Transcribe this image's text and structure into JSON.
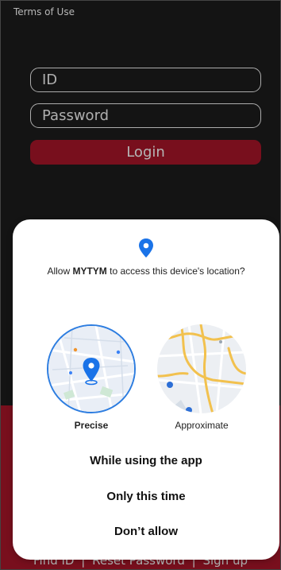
{
  "header": {
    "terms_link": "Terms of Use"
  },
  "login_form": {
    "id_placeholder": "ID",
    "password_placeholder": "Password",
    "login_label": "Login"
  },
  "footer": {
    "links": [
      "Find ID",
      "Reset Password",
      "Sign up"
    ],
    "separator": "|"
  },
  "permission_dialog": {
    "prompt_prefix": "Allow",
    "app_name": "MYTYM",
    "prompt_suffix": "to access this device's location?",
    "precise_label": "Precise",
    "approximate_label": "Approximate",
    "selected": "Precise",
    "choices": {
      "while_using": "While using the app",
      "only_this_time": "Only this time",
      "deny": "Don’t allow"
    }
  },
  "colors": {
    "brand_red": "#a01427",
    "accent_blue": "#2d7de0",
    "background_dark": "#1b1b1b"
  }
}
